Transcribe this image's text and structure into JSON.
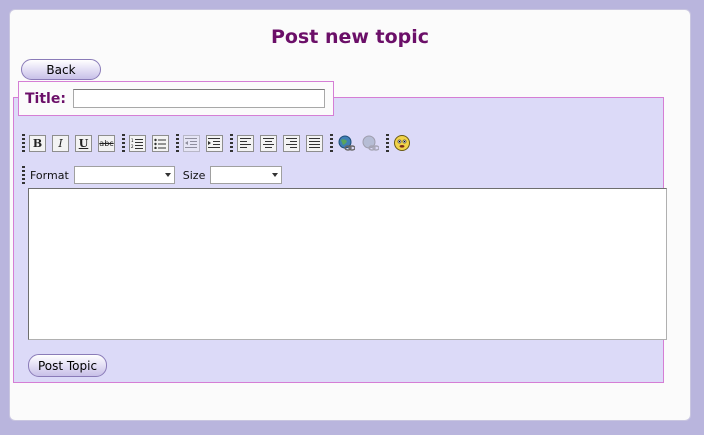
{
  "page": {
    "title": "Post new topic"
  },
  "nav": {
    "back_label": "Back"
  },
  "form": {
    "title_label": "Title:",
    "title_value": "",
    "body_value": "",
    "submit_label": "Post Topic"
  },
  "toolbar": {
    "bold_glyph": "B",
    "italic_glyph": "I",
    "underline_glyph": "U",
    "strike_glyph": "abc",
    "buttons": [
      "bold-icon",
      "italic-icon",
      "underline-icon",
      "strikethrough-icon",
      "ordered-list-icon",
      "unordered-list-icon",
      "outdent-icon",
      "indent-icon",
      "align-left-icon",
      "align-center-icon",
      "align-right-icon",
      "justify-icon",
      "insert-link-icon",
      "remove-link-icon",
      "emoticon-icon"
    ],
    "format_label": "Format",
    "format_value": "",
    "size_label": "Size",
    "size_value": ""
  },
  "colors": {
    "background": "#b9b5dd",
    "accent": "#6b0f68",
    "form_bg": "#dcdaf8",
    "form_border": "#d57ed5"
  }
}
